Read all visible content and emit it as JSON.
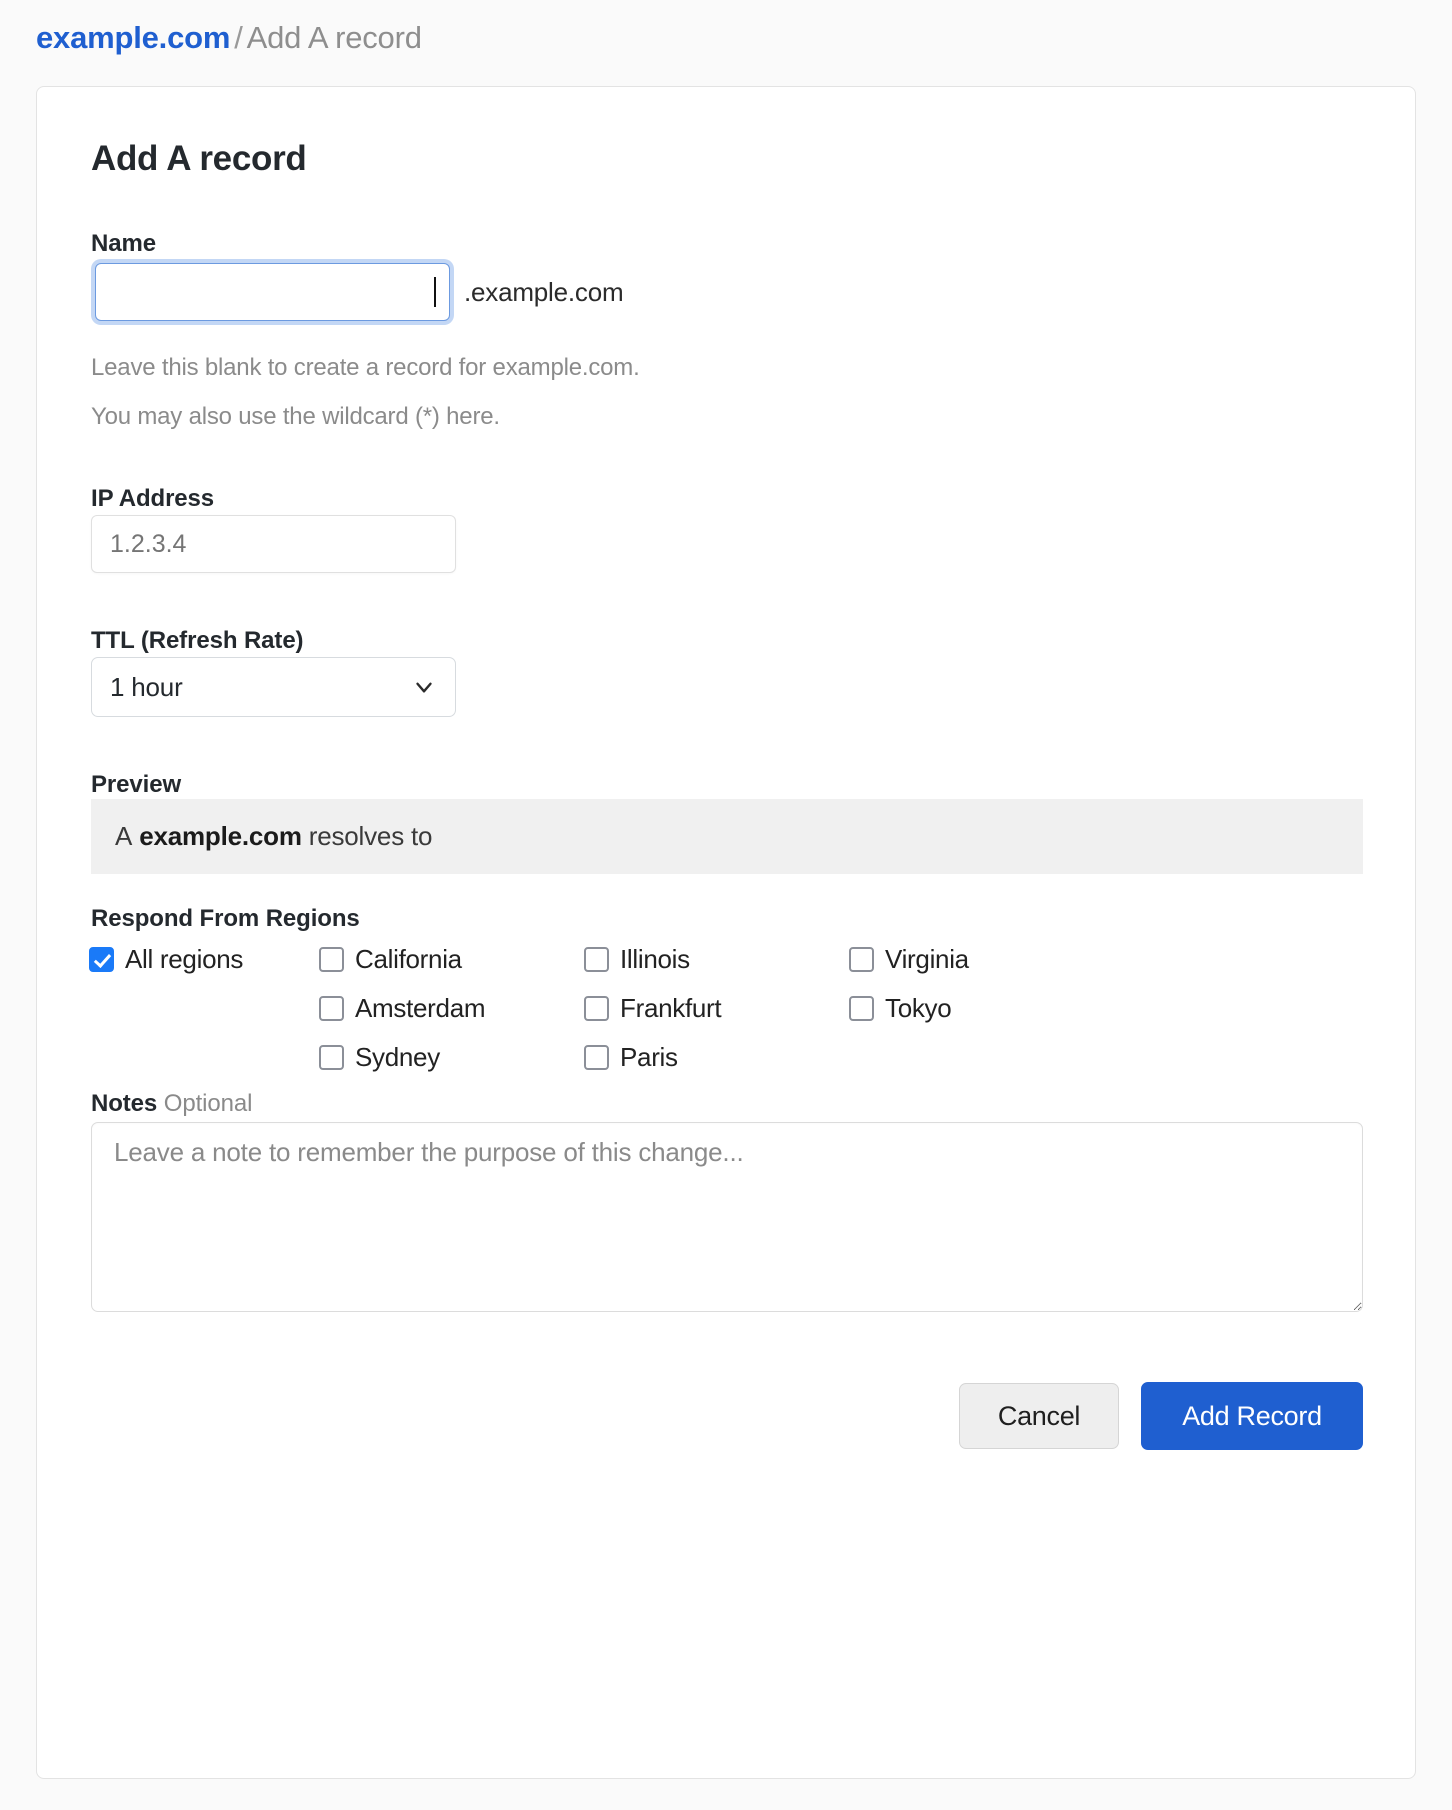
{
  "breadcrumb": {
    "domain": "example.com",
    "separator": "/",
    "current": "Add A record"
  },
  "form": {
    "title": "Add A record",
    "name": {
      "label": "Name",
      "value": "",
      "placeholder": "",
      "suffix": ".example.com",
      "help_line_1": "Leave this blank to create a record for example.com.",
      "help_line_2": "You may also use the wildcard (*) here."
    },
    "ip": {
      "label": "IP Address",
      "value": "",
      "placeholder": "1.2.3.4"
    },
    "ttl": {
      "label": "TTL (Refresh Rate)",
      "selected": "1 hour",
      "icon": "chevron-down-icon"
    },
    "preview": {
      "label": "Preview",
      "record_type": "A",
      "record_name": "example.com",
      "resolves_text": "resolves to",
      "value": ""
    },
    "regions": {
      "label": "Respond From Regions",
      "items": [
        {
          "label": "All regions",
          "checked": true
        },
        {
          "label": "California",
          "checked": false
        },
        {
          "label": "Illinois",
          "checked": false
        },
        {
          "label": "Virginia",
          "checked": false
        },
        {
          "label": "",
          "checked": false
        },
        {
          "label": "Amsterdam",
          "checked": false
        },
        {
          "label": "Frankfurt",
          "checked": false
        },
        {
          "label": "Tokyo",
          "checked": false
        },
        {
          "label": "",
          "checked": false
        },
        {
          "label": "Sydney",
          "checked": false
        },
        {
          "label": "Paris",
          "checked": false
        },
        {
          "label": "",
          "checked": false
        }
      ]
    },
    "notes": {
      "label": "Notes",
      "optional": "Optional",
      "value": "",
      "placeholder": "Leave a note to remember the purpose of this change..."
    },
    "actions": {
      "cancel": "Cancel",
      "submit": "Add Record"
    }
  },
  "colors": {
    "link": "#1f5fd0",
    "primary_button": "#1f5fd0",
    "checkbox_checked": "#1a7af8",
    "focus_ring": "#c3d7f5",
    "preview_bg": "#f0f0f0",
    "page_bg": "#fafafa"
  }
}
